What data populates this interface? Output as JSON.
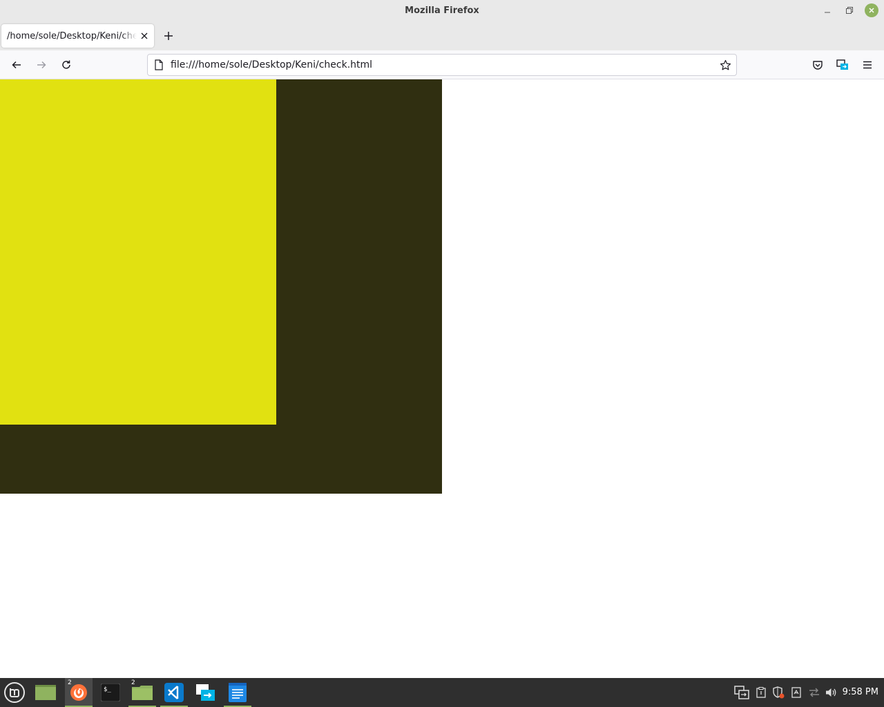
{
  "window": {
    "title": "Mozilla Firefox"
  },
  "tabs": [
    {
      "title": "/home/sole/Desktop/Keni/check.html"
    }
  ],
  "navbar": {
    "url": "file:///home/sole/Desktop/Keni/check.html"
  },
  "content": {
    "outer_color": "#302f11",
    "inner_color": "#e1e111"
  },
  "taskbar": {
    "items": [
      {
        "name": "mint-menu-icon"
      },
      {
        "name": "show-desktop-icon"
      },
      {
        "name": "firefox-icon",
        "badge": "2"
      },
      {
        "name": "terminal-icon"
      },
      {
        "name": "files-icon",
        "badge": "2"
      },
      {
        "name": "vscode-icon"
      },
      {
        "name": "sharing-icon"
      },
      {
        "name": "text-editor-icon"
      }
    ],
    "clock": "9:58 PM"
  }
}
